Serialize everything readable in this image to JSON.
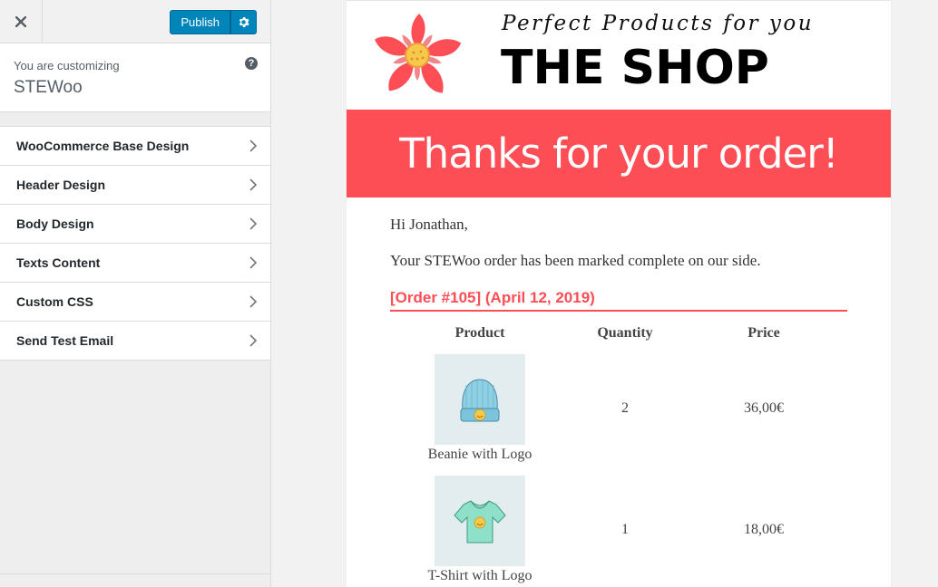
{
  "sidebar": {
    "publish_label": "Publish",
    "customizing_label": "You are customizing",
    "site_name": "STEWoo",
    "help_glyph": "?",
    "items": [
      {
        "label": "WooCommerce Base Design"
      },
      {
        "label": "Header Design"
      },
      {
        "label": "Body Design"
      },
      {
        "label": "Texts Content"
      },
      {
        "label": "Custom CSS"
      },
      {
        "label": "Send Test Email"
      }
    ]
  },
  "email": {
    "tagline": "Perfect Products for you",
    "shop_name": "THE SHOP",
    "banner": "Thanks for your order!",
    "greeting": "Hi Jonathan,",
    "message": "Your STEWoo order has been marked complete on our side.",
    "order_title": "[Order #105] (April 12, 2019)",
    "columns": {
      "product": "Product",
      "quantity": "Quantity",
      "price": "Price"
    },
    "items": [
      {
        "name": "Beanie with Logo",
        "quantity": "2",
        "price": "36,00€",
        "icon": "beanie"
      },
      {
        "name": "T-Shirt with Logo",
        "quantity": "1",
        "price": "18,00€",
        "icon": "tshirt"
      }
    ]
  },
  "colors": {
    "accent": "#fd4d55",
    "publish": "#0085ba"
  }
}
